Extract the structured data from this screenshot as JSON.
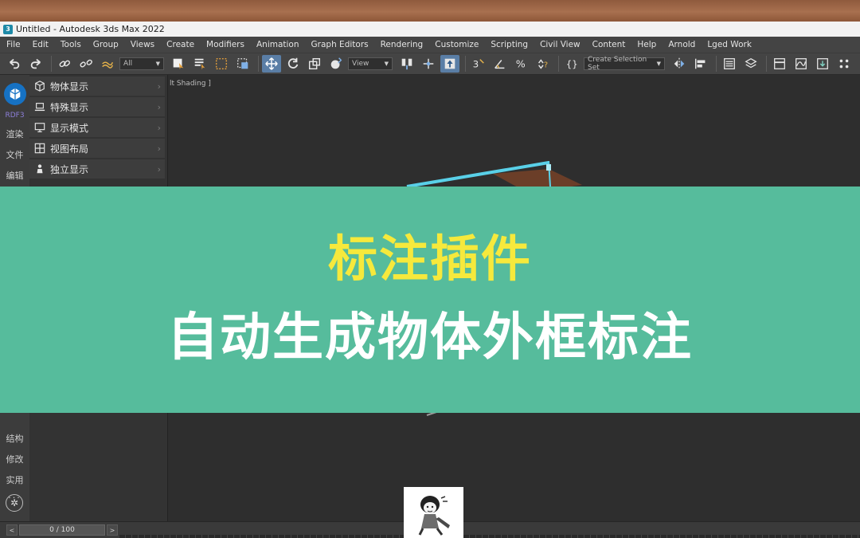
{
  "window": {
    "title": "Untitled - Autodesk 3ds Max 2022"
  },
  "menu": [
    "File",
    "Edit",
    "Tools",
    "Group",
    "Views",
    "Create",
    "Modifiers",
    "Animation",
    "Graph Editors",
    "Rendering",
    "Customize",
    "Scripting",
    "Civil View",
    "Content",
    "Help",
    "Arnold",
    "Lged Work"
  ],
  "toolbar": {
    "filter_value": "All",
    "refcoord_value": "View",
    "selection_set_placeholder": "Create Selection Set"
  },
  "rail": {
    "brand": "RDF3",
    "items_top": [
      "渲染",
      "文件",
      "编辑"
    ],
    "items_bottom": [
      "结构",
      "修改",
      "实用"
    ],
    "more": "···"
  },
  "panel": {
    "items": [
      {
        "label": "物体显示",
        "icon": "cube-icon"
      },
      {
        "label": "特殊显示",
        "icon": "laptop-icon"
      },
      {
        "label": "显示模式",
        "icon": "monitor-icon"
      },
      {
        "label": "视图布局",
        "icon": "grid-icon"
      },
      {
        "label": "独立显示",
        "icon": "person-icon"
      }
    ]
  },
  "viewport": {
    "label": "lt Shading ]"
  },
  "banner": {
    "line1": "标注插件",
    "line2": "自动生成物体外框标注"
  },
  "timeline": {
    "frame": "0 / 100"
  },
  "colors": {
    "accent": "#5a7ea6",
    "banner_bg": "#56bc9c",
    "banner_title": "#f6e93c"
  }
}
